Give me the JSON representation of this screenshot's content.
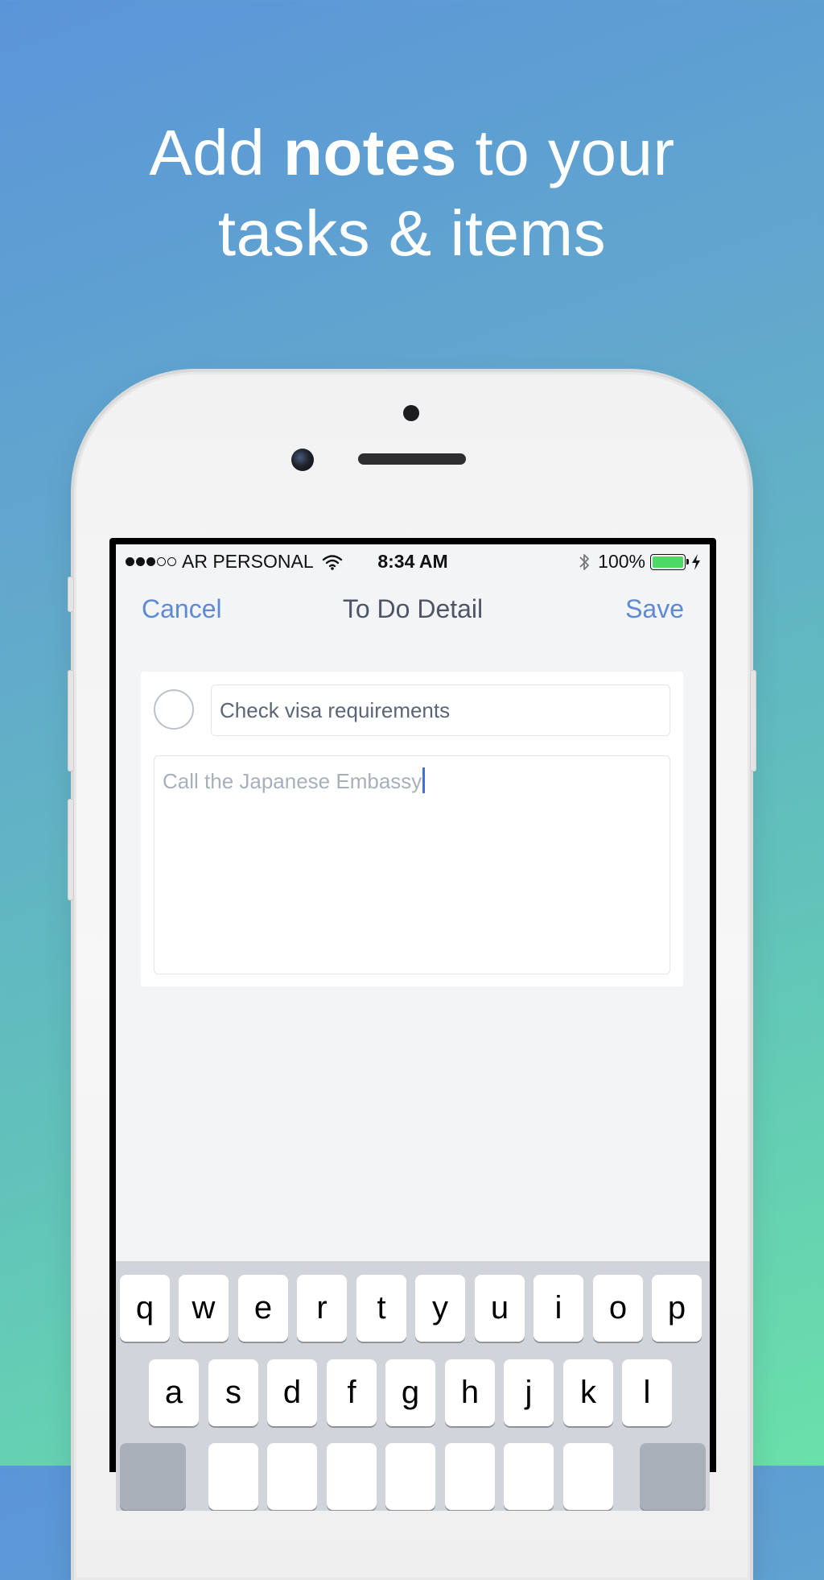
{
  "headline": {
    "part1": "Add ",
    "bold": "notes",
    "part2": " to your",
    "line2": "tasks & items"
  },
  "status_bar": {
    "carrier": "AR PERSONAL",
    "time": "8:34 AM",
    "battery": "100%"
  },
  "nav": {
    "cancel": "Cancel",
    "title": "To Do Detail",
    "save": "Save"
  },
  "task": {
    "title_value": "Check visa requirements",
    "notes_value": "Call the Japanese Embassy"
  },
  "keyboard": {
    "row1": [
      "q",
      "w",
      "e",
      "r",
      "t",
      "y",
      "u",
      "i",
      "o",
      "p"
    ],
    "row2": [
      "a",
      "s",
      "d",
      "f",
      "g",
      "h",
      "j",
      "k",
      "l"
    ]
  },
  "colors": {
    "accent": "#5f8ad3",
    "battery_fill": "#4cd964",
    "caret": "#3e6fe0"
  }
}
